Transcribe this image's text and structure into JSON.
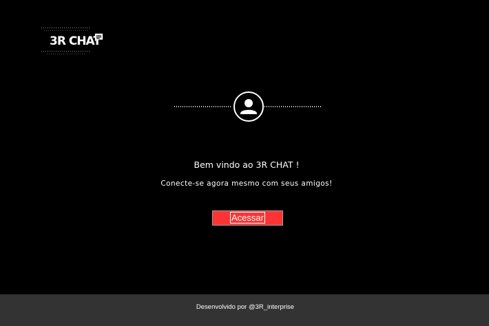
{
  "logo": {
    "text": "3R CHAT",
    "icon": "chat-bubble-icon"
  },
  "hero": {
    "avatar_icon": "user-avatar-icon",
    "welcome": "Bem vindo ao 3R CHAT !",
    "subtitle": "Conecte-se agora mesmo com seus amigos!"
  },
  "actions": {
    "access_label": "Acessar"
  },
  "footer": {
    "credit": "Desenvolvido por @3R_interprise"
  },
  "colors": {
    "background": "#000000",
    "accent": "#ff3333",
    "footer_bg": "#333333",
    "text": "#ffffff"
  }
}
